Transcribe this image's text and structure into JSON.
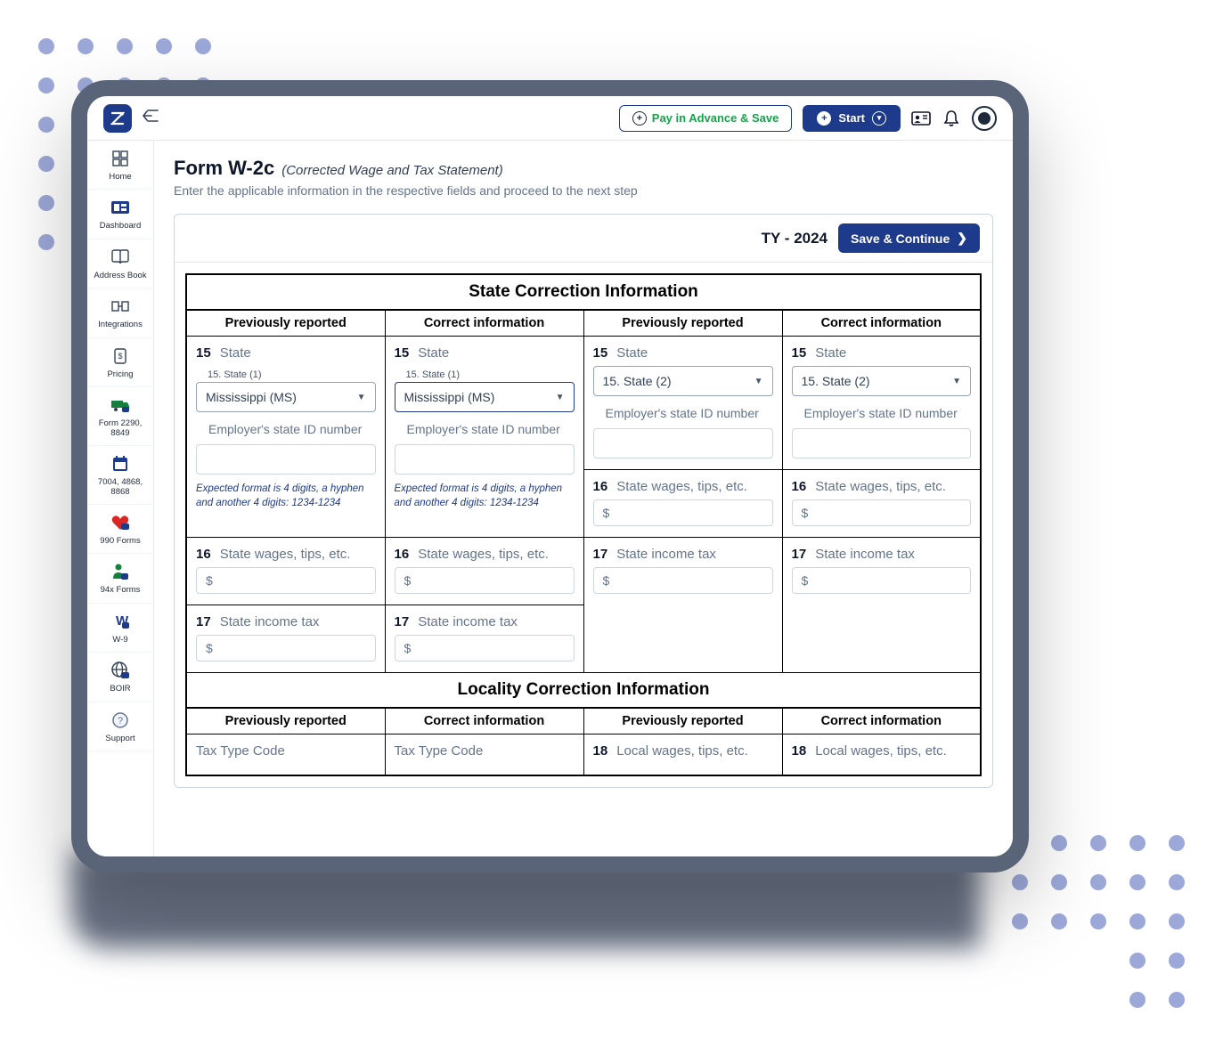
{
  "header": {
    "pay_advance": "Pay in Advance & Save",
    "start": "Start"
  },
  "sidebar": {
    "items": [
      {
        "label": "Home"
      },
      {
        "label": "Dashboard"
      },
      {
        "label": "Address Book"
      },
      {
        "label": "Integrations"
      },
      {
        "label": "Pricing"
      },
      {
        "label": "Form 2290, 8849"
      },
      {
        "label": "7004, 4868, 8868"
      },
      {
        "label": "990 Forms"
      },
      {
        "label": "94x Forms"
      },
      {
        "label": "W-9"
      },
      {
        "label": "BOIR"
      },
      {
        "label": "Support"
      }
    ]
  },
  "page": {
    "title": "Form W-2c",
    "subtitle": "(Corrected Wage and Tax Statement)",
    "desc": "Enter the applicable information in the respective fields and proceed to the next step",
    "tax_year": "TY - 2024",
    "save_btn": "Save & Continue"
  },
  "state_section": {
    "title": "State Correction Information",
    "col_prev": "Previously reported",
    "col_corr": "Correct information",
    "row15_num": "15",
    "row15_txt": "State",
    "fieldset1": "15. State (1)",
    "state1_value": "Mississippi (MS)",
    "state2_placeholder": "15. State (2)",
    "employer_id_label": "Employer's state ID number",
    "hint": "Expected format is 4 digits, a hyphen and another 4 digits: 1234-1234",
    "row16_num": "16",
    "row16_txt": "State wages, tips, etc.",
    "row17_num": "17",
    "row17_txt": "State income tax"
  },
  "locality_section": {
    "title": "Locality Correction Information",
    "tax_type": "Tax Type Code",
    "row18_num": "18",
    "row18_txt": "Local wages, tips, etc."
  }
}
